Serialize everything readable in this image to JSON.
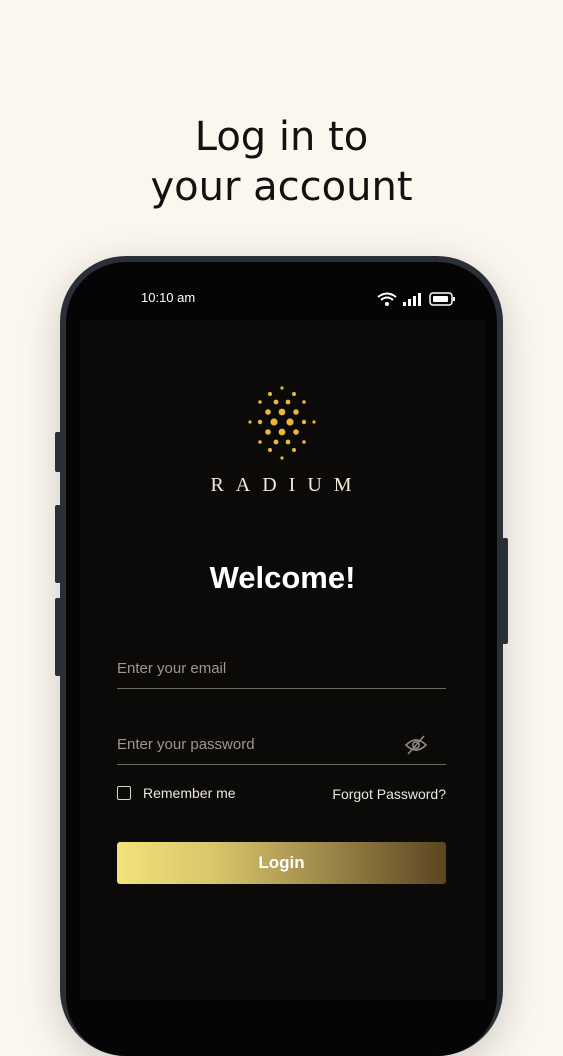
{
  "headline": {
    "line1": "Log in to",
    "line2": "your account"
  },
  "status_bar": {
    "time": "10:10 am",
    "icons": [
      "wifi-icon",
      "signal-icon",
      "battery-icon"
    ]
  },
  "brand": {
    "name": "RADIUM",
    "logo_icon": "radium-dots-logo",
    "accent": "#e8b938"
  },
  "welcome": "Welcome!",
  "form": {
    "email": {
      "value": "",
      "placeholder": "Enter your email"
    },
    "password": {
      "value": "",
      "placeholder": "Enter your password",
      "toggle_icon": "eye-off-icon"
    },
    "remember_label": "Remember me",
    "remember_checked": false,
    "forgot_label": "Forgot Password?",
    "login_label": "Login"
  },
  "colors": {
    "page_bg": "#fbf6ee",
    "screen_bg": "#0c0a08",
    "button_gradient_start": "#f3e27a",
    "button_gradient_end": "#5a4520"
  }
}
